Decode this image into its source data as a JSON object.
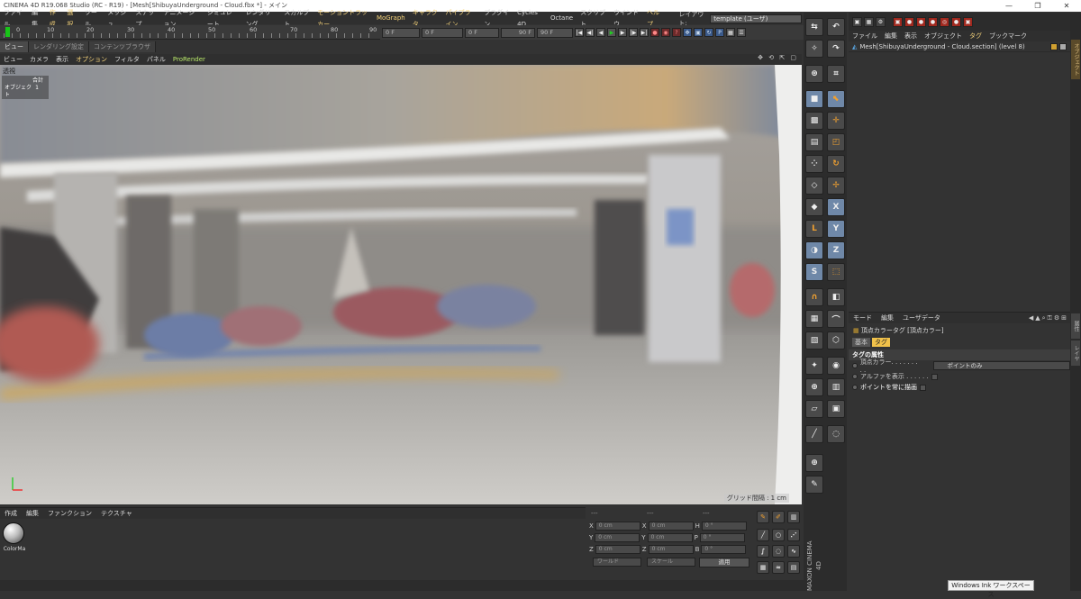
{
  "window": {
    "title": "CINEMA 4D R19.068 Studio (RC - R19) - [Mesh[ShibuyaUnderground - Cloud.fbx *] - メイン",
    "minimize": "—",
    "maximize": "❐",
    "close": "✕"
  },
  "menubar": {
    "items": [
      "ファイル",
      "編集",
      "作成",
      "選択",
      "ツール",
      "メッシュ",
      "スナップ",
      "アニメーション",
      "シミュレート",
      "レンダリング",
      "スカルプト",
      "モーショントラッカー",
      "MoGraph",
      "キャラクタ",
      "パイプライン",
      "プラグイン",
      "Cycles 4D",
      "Octane",
      "スクリプト",
      "ウインドウ",
      "ヘルプ"
    ],
    "layout_label": "レイアウト:",
    "layout_value": "template (ユーザ)"
  },
  "timeline": {
    "ticks": [
      "0",
      "10",
      "20",
      "30",
      "40",
      "50",
      "60",
      "70",
      "80",
      "90"
    ],
    "current_frame": "0 F",
    "start_frame": "0 F",
    "range_start": "0 F",
    "range_end": "90 F",
    "end_frame": "90 F"
  },
  "viewport": {
    "tabs": [
      "ビュー",
      "レンダリング設定",
      "コンテンツブラウザ"
    ],
    "menu": [
      "ビュー",
      "カメラ",
      "表示",
      "オプション",
      "フィルタ",
      "パネル",
      "ProRender"
    ],
    "nav_icons": "✥ ⟲ ⇱ ▢",
    "camera_label": "透視",
    "stats_total": "合計",
    "stats_object_label": "オブジェクト",
    "stats_object_value": "1",
    "grid_label": "グリッド間隔 : 1 cm"
  },
  "material_manager": {
    "menu": [
      "作成",
      "編集",
      "ファンクション",
      "テクスチャ"
    ],
    "material_name": "ColorMa"
  },
  "coordinates": {
    "header_left": "---",
    "header_mid": "---",
    "header_right": "---",
    "rows": [
      {
        "a": "X",
        "av": "0 cm",
        "b": "X",
        "bv": "0 cm",
        "c": "H",
        "cv": "0 °"
      },
      {
        "a": "Y",
        "av": "0 cm",
        "b": "Y",
        "bv": "0 cm",
        "c": "P",
        "cv": "0 °"
      },
      {
        "a": "Z",
        "av": "0 cm",
        "b": "Z",
        "bv": "0 cm",
        "c": "B",
        "cv": "0 °"
      }
    ],
    "mode_world": "ワールド",
    "mode_scale": "スケール",
    "apply": "適用"
  },
  "side_logo": {
    "brand": "MAXON",
    "product": "CINEMA 4D"
  },
  "object_manager": {
    "menu": [
      "ファイル",
      "編集",
      "表示",
      "オブジェクト",
      "タグ",
      "ブックマーク"
    ],
    "object_name": "Mesh[ShibuyaUnderground - Cloud.section] (level 8)"
  },
  "attribute_manager": {
    "menu": [
      "モード",
      "編集",
      "ユーザデータ"
    ],
    "tag_title": "頂点カラータグ [頂点カラー]",
    "tabs": [
      "基本",
      "タグ"
    ],
    "section": "タグの属性",
    "vertex_color_label": "頂点カラー. . . . . . . . .",
    "vertex_color_value": "ポイントのみ",
    "show_alpha": "アルファを表示 . . . . . .",
    "draw_points": "ポイントを常に描画"
  },
  "right_tabs": [
    "オブジェクト",
    "属性",
    "レイヤ"
  ],
  "tooltip": "Windows Ink ワークスペース"
}
